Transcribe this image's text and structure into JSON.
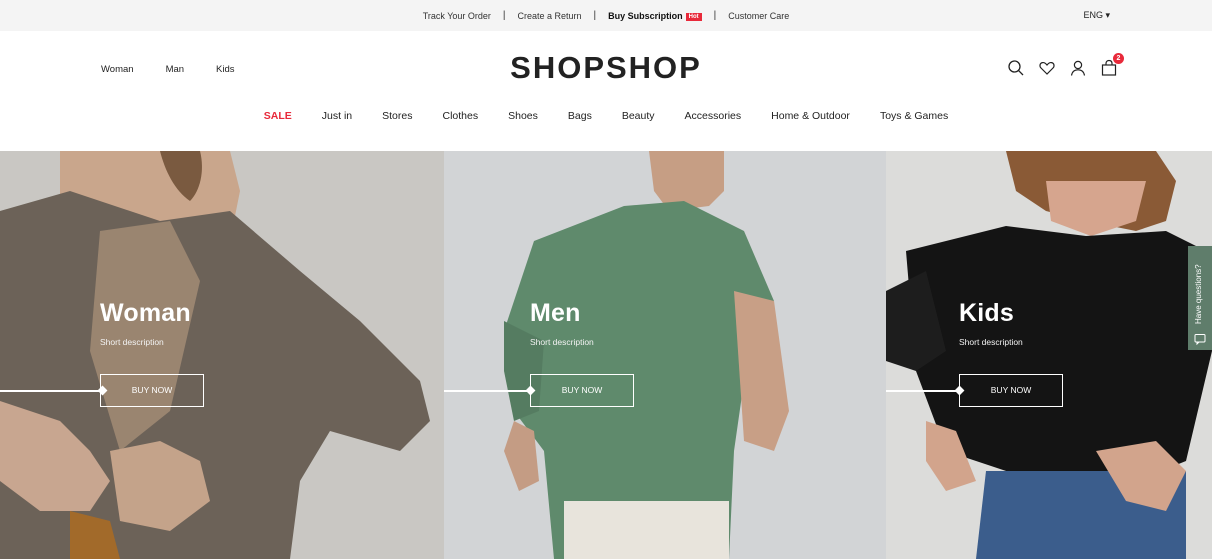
{
  "topbar": {
    "links": [
      {
        "label": "Track Your Order"
      },
      {
        "label": "Create a Return"
      },
      {
        "label": "Buy Subscription",
        "badge": "Hot"
      },
      {
        "label": "Customer Care"
      }
    ],
    "separator": "|",
    "language": "ENG ▾"
  },
  "header": {
    "gender_nav": [
      "Woman",
      "Man",
      "Kids"
    ],
    "logo": "SHOPSHOP",
    "icons": [
      "search-icon",
      "heart-icon",
      "user-icon",
      "bag-icon"
    ],
    "cart_count": "2",
    "main_nav": [
      "SALE",
      "Just in",
      "Stores",
      "Clothes",
      "Shoes",
      "Bags",
      "Beauty",
      "Accessories",
      "Home & Outdoor",
      "Toys & Games"
    ]
  },
  "hero": {
    "panels": [
      {
        "title": "Woman",
        "description": "Short description",
        "button": "BUY NOW"
      },
      {
        "title": "Men",
        "description": "Short description",
        "button": "BUY NOW"
      },
      {
        "title": "Kids",
        "description": "Short description",
        "button": "BUY NOW"
      }
    ]
  },
  "side_tab": {
    "label": "Have questions?"
  },
  "colors": {
    "accent": "#e8293a",
    "side_tab": "#5f7d6b",
    "topbar_bg": "#f4f4f4"
  }
}
